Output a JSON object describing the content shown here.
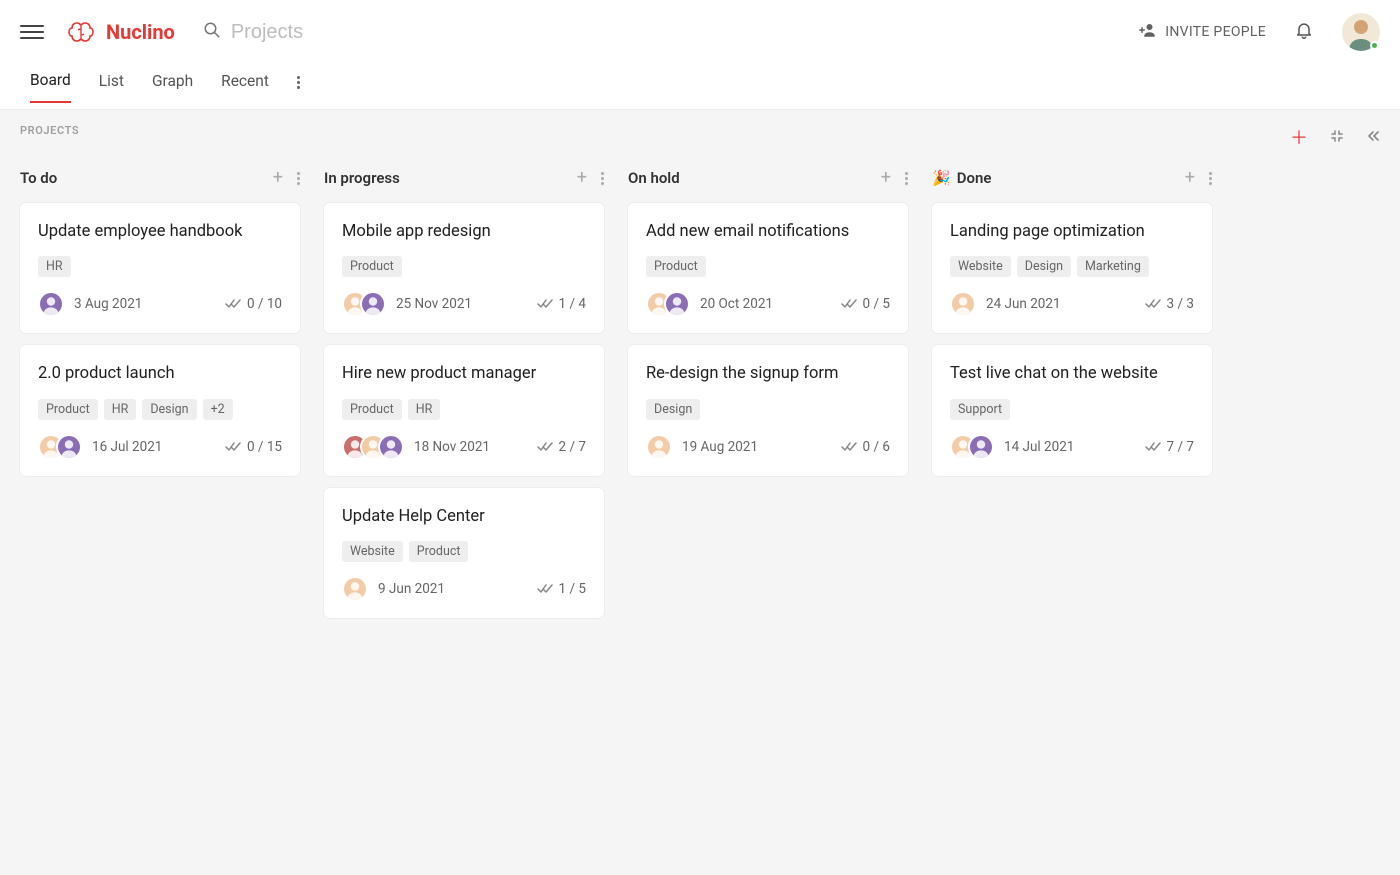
{
  "app": {
    "name": "Nuclino"
  },
  "search": {
    "placeholder": "Projects"
  },
  "topbar": {
    "inviteLabel": "INVITE PEOPLE"
  },
  "tabs": {
    "items": [
      "Board",
      "List",
      "Graph",
      "Recent"
    ],
    "active": "Board"
  },
  "section": {
    "title": "PROJECTS"
  },
  "board": {
    "columns": [
      {
        "title": "To do",
        "emoji": "",
        "cards": [
          {
            "title": "Update employee handbook",
            "tags": [
              "HR"
            ],
            "avatars": [
              "a"
            ],
            "date": "3 Aug 2021",
            "progress": "0 / 10"
          },
          {
            "title": "2.0 product launch",
            "tags": [
              "Product",
              "HR",
              "Design",
              "+2"
            ],
            "avatars": [
              "b",
              "a"
            ],
            "date": "16 Jul 2021",
            "progress": "0 / 15"
          }
        ]
      },
      {
        "title": "In progress",
        "emoji": "",
        "cards": [
          {
            "title": "Mobile app redesign",
            "tags": [
              "Product"
            ],
            "avatars": [
              "b",
              "a"
            ],
            "date": "25 Nov 2021",
            "progress": "1 / 4"
          },
          {
            "title": "Hire new product manager",
            "tags": [
              "Product",
              "HR"
            ],
            "avatars": [
              "c",
              "b",
              "a"
            ],
            "date": "18 Nov 2021",
            "progress": "2 / 7"
          },
          {
            "title": "Update Help Center",
            "tags": [
              "Website",
              "Product"
            ],
            "avatars": [
              "b"
            ],
            "date": "9 Jun 2021",
            "progress": "1 / 5"
          }
        ]
      },
      {
        "title": "On hold",
        "emoji": "",
        "cards": [
          {
            "title": "Add new email notifications",
            "tags": [
              "Product"
            ],
            "avatars": [
              "b",
              "a"
            ],
            "date": "20 Oct 2021",
            "progress": "0 / 5"
          },
          {
            "title": "Re-design the signup form",
            "tags": [
              "Design"
            ],
            "avatars": [
              "b"
            ],
            "date": "19 Aug 2021",
            "progress": "0 / 6"
          }
        ]
      },
      {
        "title": "Done",
        "emoji": "🎉",
        "cards": [
          {
            "title": "Landing page optimization",
            "tags": [
              "Website",
              "Design",
              "Marketing"
            ],
            "avatars": [
              "b"
            ],
            "date": "24 Jun 2021",
            "progress": "3 / 3"
          },
          {
            "title": "Test live chat on the website",
            "tags": [
              "Support"
            ],
            "avatars": [
              "b",
              "a"
            ],
            "date": "14 Jul 2021",
            "progress": "7 / 7"
          }
        ]
      }
    ]
  }
}
